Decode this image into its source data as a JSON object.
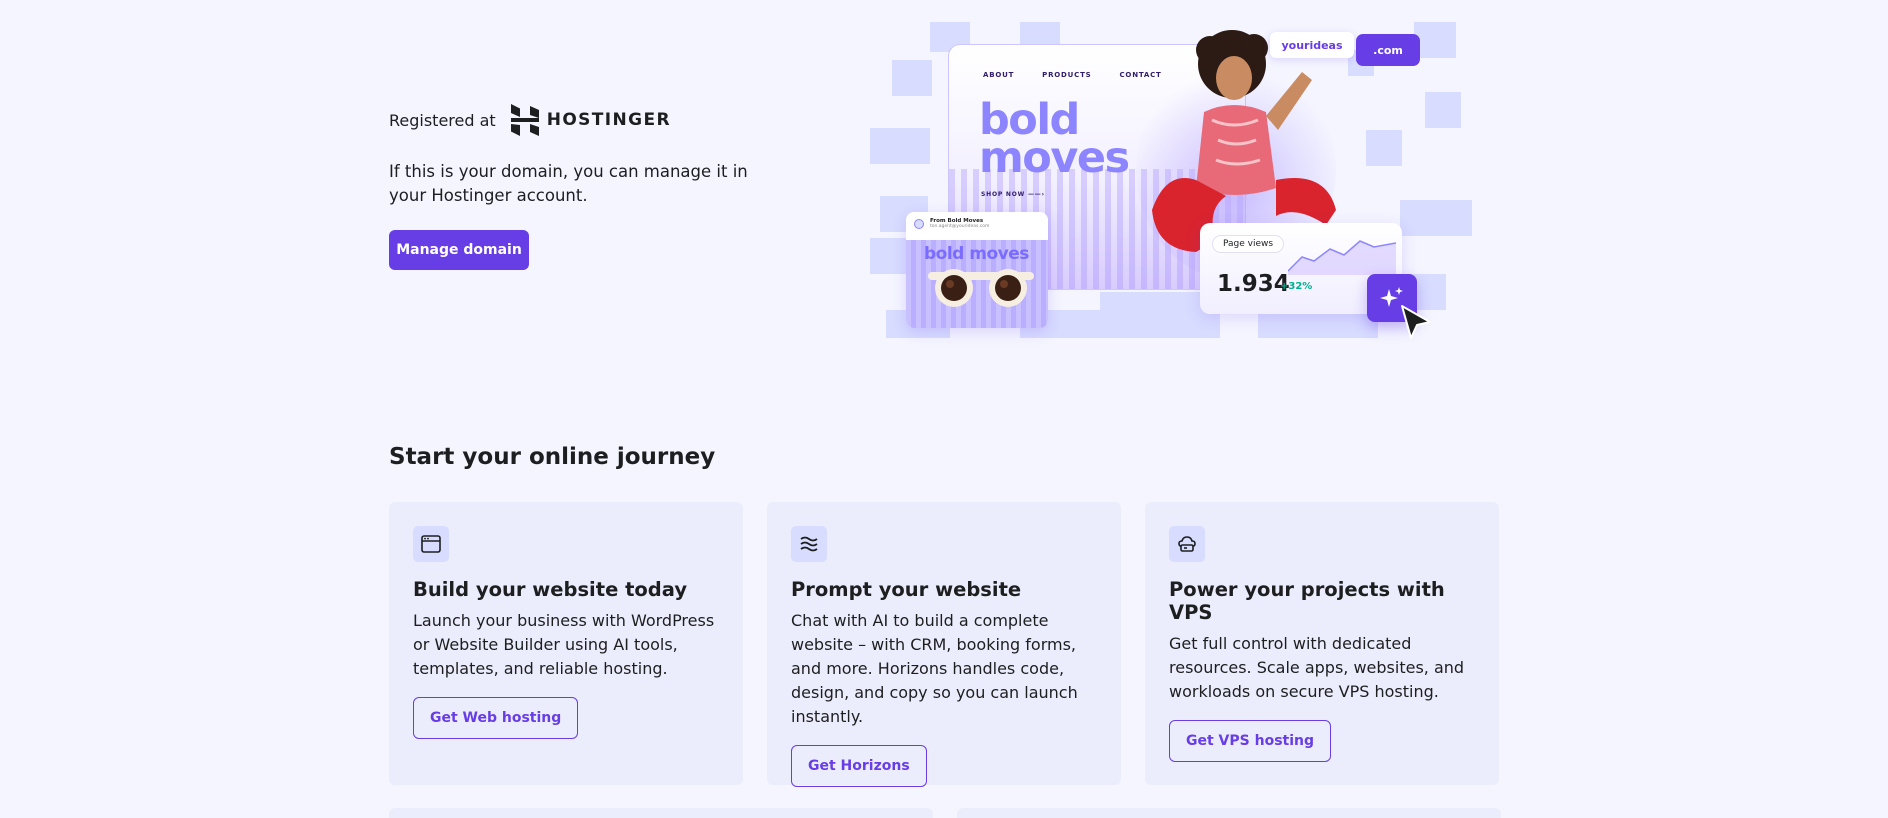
{
  "hero": {
    "registered_label": "Registered at",
    "brand_name": "HOSTINGER",
    "description": "If this is your domain, you can manage it in your Hostinger account.",
    "manage_button": "Manage domain",
    "illustration": {
      "nav": [
        "ABOUT",
        "PRODUCTS",
        "CONTACT"
      ],
      "headline_1": "bold",
      "headline_2": "moves",
      "shop_now": "SHOP NOW",
      "domain_name": "yourideas",
      "domain_tld": ".com",
      "email_from": "From Bold Moves",
      "email_sub": "ton.agent@yourideas.com",
      "email_title": "bold moves",
      "page_views_label": "Page views",
      "page_views_value": "1.934",
      "page_views_delta": "+32%"
    }
  },
  "journey": {
    "title": "Start your online journey",
    "cards": [
      {
        "icon": "browser-window-icon",
        "title": "Build your website today",
        "description": "Launch your business with WordPress or Website Builder using AI tools, templates, and reliable hosting.",
        "button": "Get Web hosting"
      },
      {
        "icon": "ai-waves-icon",
        "title": "Prompt your website",
        "description": "Chat with AI to build a complete website – with CRM, booking forms, and more. Horizons handles code, design, and copy so you can launch instantly.",
        "button": "Get Horizons"
      },
      {
        "icon": "server-cloud-icon",
        "title": "Power your projects with VPS",
        "description": "Get full control with dedicated resources. Scale apps, websites, and workloads on secure VPS hosting.",
        "button": "Get VPS hosting"
      }
    ]
  },
  "colors": {
    "accent": "#673de6",
    "background": "#f4f5ff",
    "card": "#ecedfc",
    "illustration_tile": "#d8dcff",
    "positive": "#00b090"
  }
}
